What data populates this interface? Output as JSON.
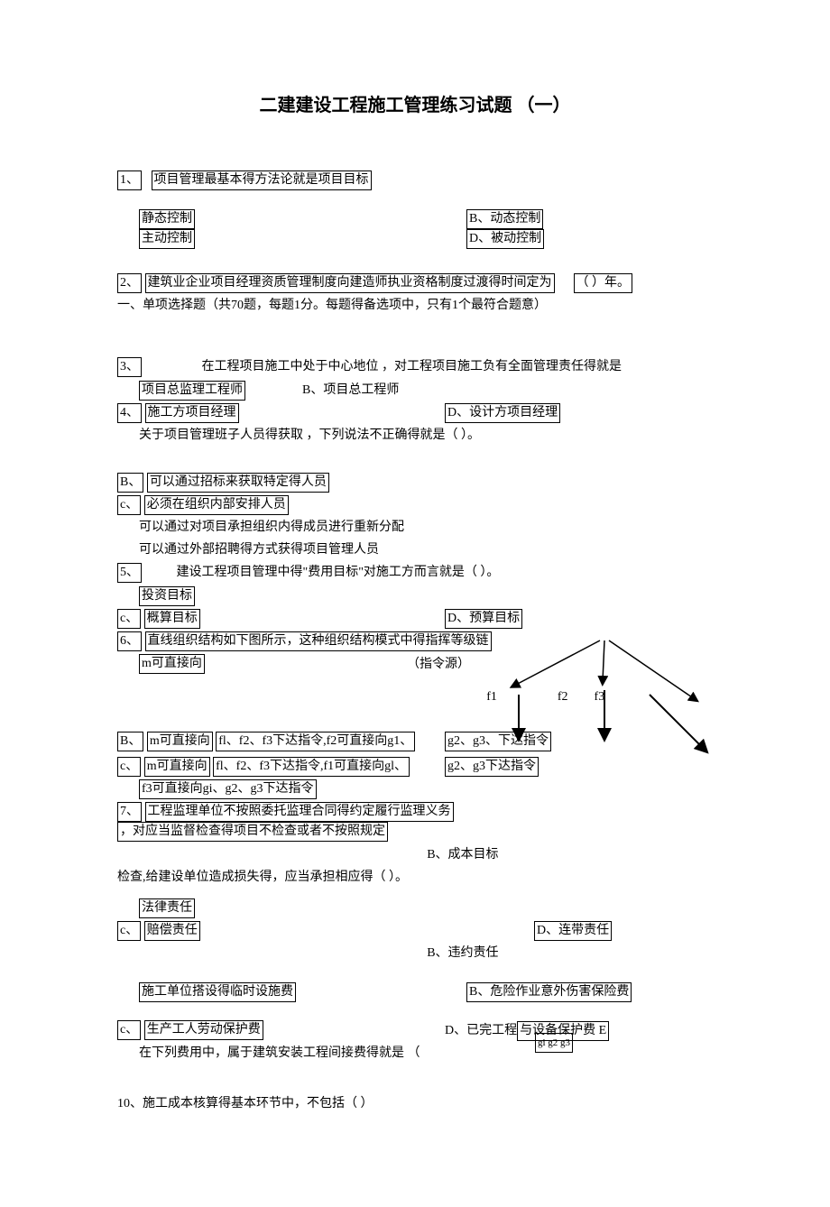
{
  "title": "二建建设工程施工管理练习试题 （一）",
  "q1": {
    "num": "1、",
    "text": "项目管理最基本得方法论就是项目目标",
    "a": "静态控制",
    "b": "B、动态控制",
    "c": "主动控制",
    "d": "D、被动控制"
  },
  "q2": {
    "num": "2、",
    "text": "建筑业企业项目经理资质管理制度向建造师执业资格制度过渡得时间定为",
    "blank": "（ ）年。",
    "sub": "一、单项选择题（共70题，每题1分。每题得备选项中，只有1个最符合题意）"
  },
  "q3": {
    "num": "3、",
    "text": "在工程项目施工中处于中心地位    ，对工程项目施工负有全面管理责任得就是",
    "a": "项目总监理工程师",
    "b": "B、项目总工程师",
    "cnum": "4、",
    "c": "施工方项目经理",
    "d": "D、设计方项目经理",
    "tail": "关于项目管理班子人员得获取  ，下列说法不正确得就是（ ）。"
  },
  "q4": {
    "bnum": "B、",
    "b": "可以通过招标来获取特定得人员",
    "cnum": "c、",
    "c": "必须在组织内部安排人员",
    "c2": "可以通过对项目承担组织内得成员进行重新分配",
    "c3": "可以通过外部招聘得方式获得项目管理人员"
  },
  "q5": {
    "num": "5、",
    "text": "建设工程项目管理中得\"费用目标\"对施工方而言就是（ ）。",
    "a": "投资目标",
    "cnum": "c、",
    "c": "概算目标",
    "d": "D、预算目标"
  },
  "q6": {
    "num": "6、",
    "text": "直线组织结构如下图所示，这种组织结构模式中得指挥等级链",
    "m": "m可直接向",
    "src": "（指令源）",
    "f1": "f1",
    "f2": "f2",
    "f3": "f3",
    "bnum": "B、",
    "bm": "m可直接向",
    "btext": "fl、f2、f3下达指令,f2可直接向g1、",
    "bright": "g2、g3、下达指令",
    "cnum": "c、",
    "cm": "m可直接向",
    "ctext": "fl、f2、f3下达指令,f1可直接向gl、",
    "cright": "g2、g3下达指令",
    "ctail": "f3可直接向gi、g2、g3下达指令"
  },
  "q7": {
    "num": "7、",
    "text": "工程监理单位不按照委托监理合同得约定履行监理义务",
    "text2": "，对应当监督检查得项目不检查或者不按照规定",
    "b": "B、成本目标",
    "tail": "检查,给建设单位造成损失得，应当承担相应得（ ）。",
    "a": "法律责任",
    "cnum": "c、",
    "c": "赔偿责任",
    "d": "D、连带责任",
    "b2": "B、违约责任"
  },
  "q9": {
    "a": "施工单位搭设得临时设施费",
    "b": "B、危险作业意外伤害保险费",
    "cnum": "c、",
    "c": "生产工人劳动保护费",
    "d": "D、已完工程",
    "dright": "与设备保护费    E",
    "g": "gi g2 g3",
    "tail": "在下列费用中，属于建筑安装工程间接费得就是        （"
  },
  "q10": "10、施工成本核算得基本环节中，不包括（ ）"
}
